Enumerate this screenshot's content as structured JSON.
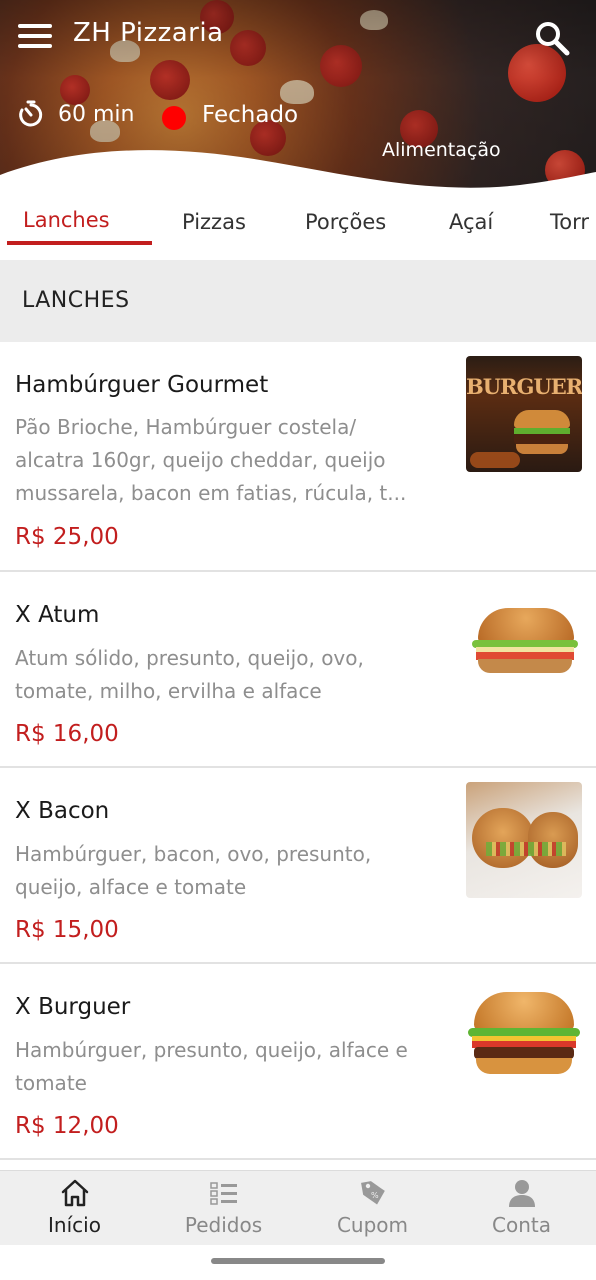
{
  "header": {
    "store_name": "ZH Pizzaria",
    "delivery_time": "60 min",
    "status": "Fechado",
    "status_color": "#ff0000",
    "category": "Alimentação"
  },
  "tabs": [
    {
      "label": "Lanches",
      "active": true
    },
    {
      "label": "Pizzas",
      "active": false
    },
    {
      "label": "Porções",
      "active": false
    },
    {
      "label": "Açaí",
      "active": false
    },
    {
      "label": "Torr",
      "active": false
    }
  ],
  "section": {
    "title": "LANCHES"
  },
  "items": [
    {
      "name": "Hambúrguer Gourmet",
      "desc_lines": [
        "Pão Brioche, Hambúrguer costela/",
        "alcatra 160gr, queijo cheddar, queijo",
        "mussarela, bacon em fatias, rúcula, t..."
      ],
      "price": "R$ 25,00",
      "image_text": "BURGUER"
    },
    {
      "name": "X Atum",
      "desc_lines": [
        "Atum sólido, presunto, queijo, ovo,",
        "tomate, milho, ervilha e alface"
      ],
      "price": "R$ 16,00"
    },
    {
      "name": "X Bacon",
      "desc_lines": [
        "Hambúrguer, bacon, ovo, presunto,",
        "queijo, alface e tomate"
      ],
      "price": "R$ 15,00"
    },
    {
      "name": "X Burguer",
      "desc_lines": [
        "Hambúrguer, presunto, queijo, alface e",
        "tomate"
      ],
      "price": "R$ 12,00"
    }
  ],
  "bottom_nav": [
    {
      "label": "Início",
      "icon": "home-icon",
      "active": true
    },
    {
      "label": "Pedidos",
      "icon": "orders-list-icon",
      "active": false
    },
    {
      "label": "Cupom",
      "icon": "coupon-tag-icon",
      "active": false
    },
    {
      "label": "Conta",
      "icon": "user-icon",
      "active": false
    }
  ],
  "colors": {
    "accent": "#c21e1e",
    "muted_text": "#8e8e8e"
  }
}
